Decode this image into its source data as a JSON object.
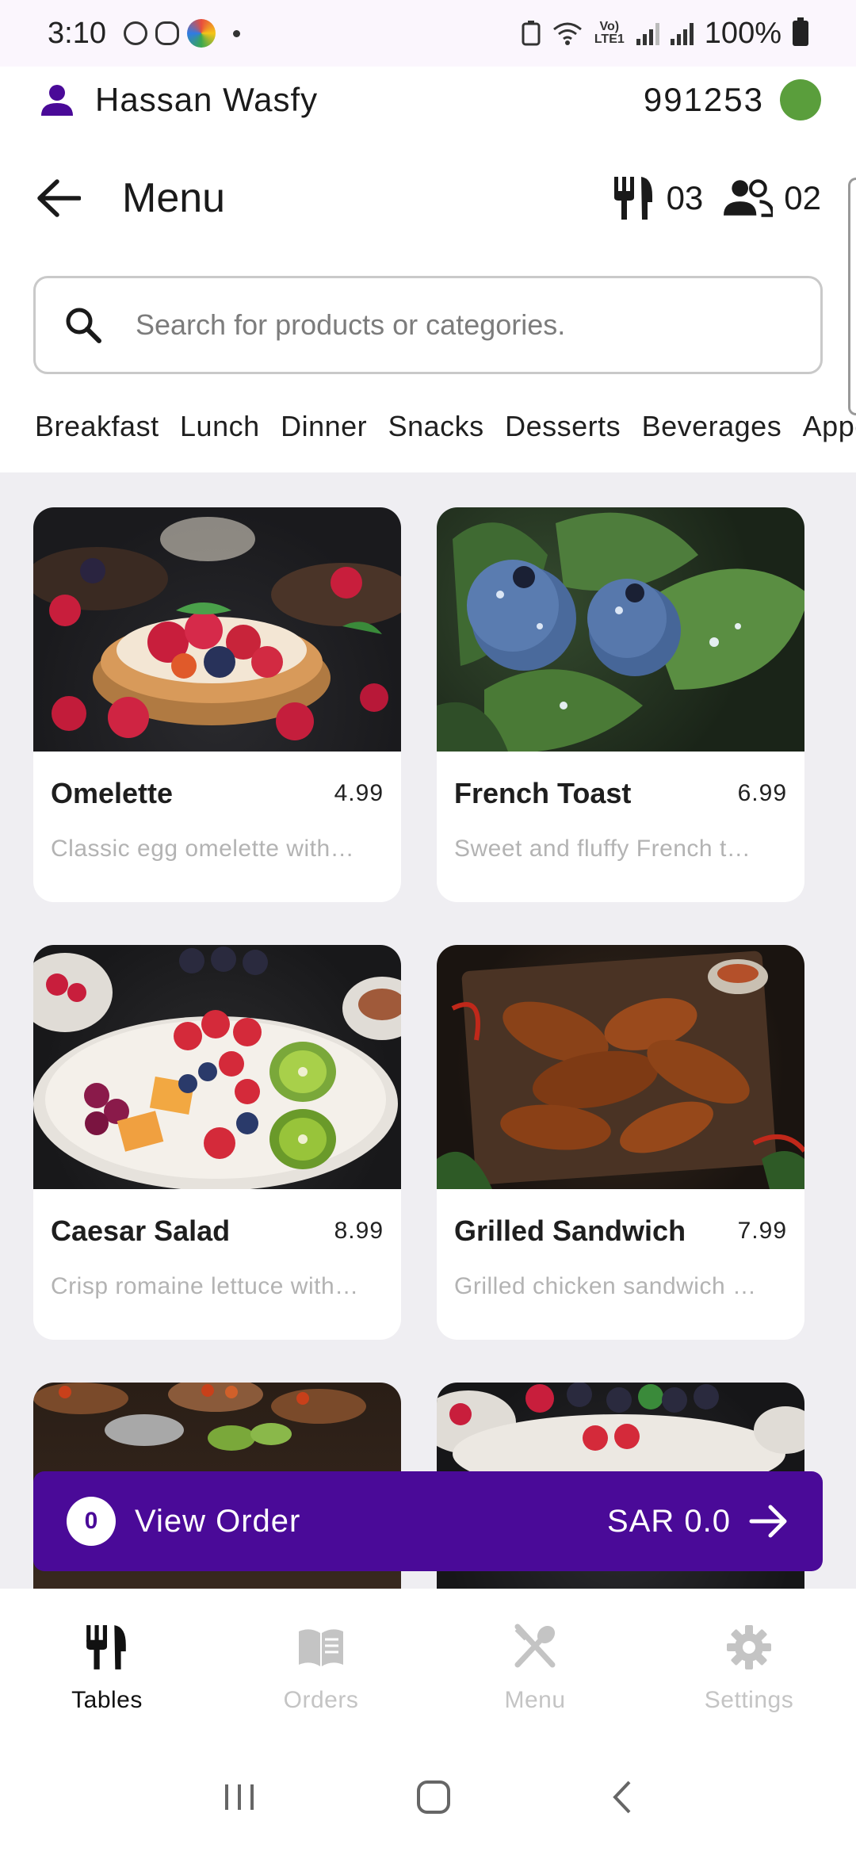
{
  "status_bar": {
    "time": "3:10",
    "lte_label": "Vo) LTE1",
    "battery": "100%"
  },
  "user": {
    "name": "Hassan Wasfy",
    "id": "991253",
    "status_color": "#5a9e3c"
  },
  "header": {
    "title": "Menu",
    "tables_count": "03",
    "guests_count": "02"
  },
  "search": {
    "placeholder": "Search for products or categories.",
    "value": ""
  },
  "categories": [
    "Breakfast",
    "Lunch",
    "Dinner",
    "Snacks",
    "Desserts",
    "Beverages",
    "Appetizers"
  ],
  "products": [
    {
      "name": "Omelette",
      "price": "4.99",
      "description": "Classic egg omelette with…"
    },
    {
      "name": "French Toast",
      "price": "6.99",
      "description": "Sweet and fluffy French t…"
    },
    {
      "name": "Caesar Salad",
      "price": "8.99",
      "description": "Crisp romaine lettuce with…"
    },
    {
      "name": "Grilled Sandwich",
      "price": "7.99",
      "description": "Grilled chicken sandwich …"
    }
  ],
  "order_bar": {
    "count": "0",
    "label": "View Order",
    "total": "SAR 0.0"
  },
  "bottom_nav": [
    {
      "label": "Tables",
      "icon": "utensils-icon",
      "active": true
    },
    {
      "label": "Orders",
      "icon": "book-icon",
      "active": false
    },
    {
      "label": "Menu",
      "icon": "fork-spoon-icon",
      "active": false
    },
    {
      "label": "Settings",
      "icon": "gear-icon",
      "active": false
    }
  ],
  "colors": {
    "accent": "#4a0a98",
    "user_icon": "#4a0a98",
    "background_grid": "#efeef2",
    "inactive_nav": "#c4c4c4"
  }
}
